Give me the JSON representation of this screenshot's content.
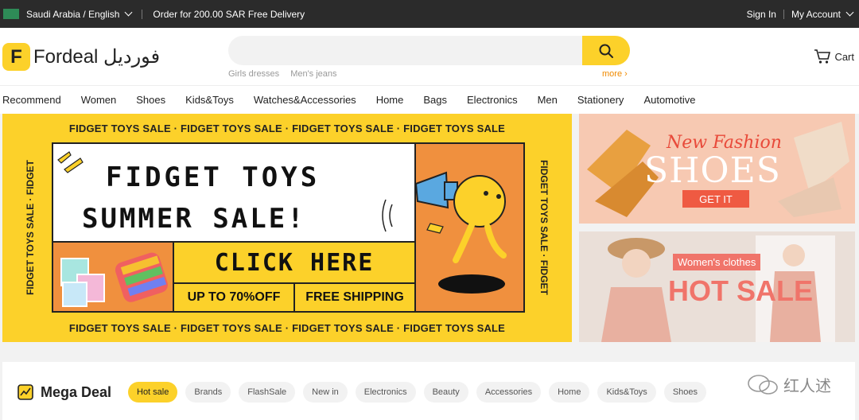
{
  "topbar": {
    "flag_text": "",
    "region": "Saudi Arabia / English",
    "promo": "Order for 200.00 SAR Free Delivery",
    "sign_in": "Sign In",
    "my_account": "My Account"
  },
  "header": {
    "logo_letter": "F",
    "logo_text": "Fordeal فورديل",
    "search_placeholder": "",
    "hints": [
      "Girls dresses",
      "Men's jeans"
    ],
    "more": "more ›",
    "cart": "Cart"
  },
  "nav": [
    "Recommend",
    "Women",
    "Shoes",
    "Kids&Toys",
    "Watches&Accessories",
    "Home",
    "Bags",
    "Electronics",
    "Men",
    "Stationery",
    "Automotive"
  ],
  "main_banner": {
    "ticker": "FIDGET TOYS SALE · FIDGET TOYS SALE · FIDGET TOYS SALE · FIDGET TOYS SALE",
    "vertical": "FIDGET TOYS SALE · FIDGET",
    "line1": "FIDGET TOYS",
    "line2": "SUMMER SALE!",
    "cta": "CLICK HERE",
    "discount": "UP TO 70%OFF",
    "shipping": "FREE SHIPPING"
  },
  "side_banner_1": {
    "title": "New Fashion",
    "subtitle": "SHOES",
    "button": "GET IT"
  },
  "side_banner_2": {
    "tag": "Women's clothes",
    "title": "HOT SALE"
  },
  "mega_deal": {
    "title": "Mega Deal",
    "chips": [
      "Hot sale",
      "Brands",
      "FlashSale",
      "New in",
      "Electronics",
      "Beauty",
      "Accessories",
      "Home",
      "Kids&Toys",
      "Shoes"
    ]
  },
  "watermark": "红人述",
  "colors": {
    "brand_yellow": "#fcd12a",
    "topbar": "#2b2b2b",
    "accent_orange": "#f0903e"
  }
}
